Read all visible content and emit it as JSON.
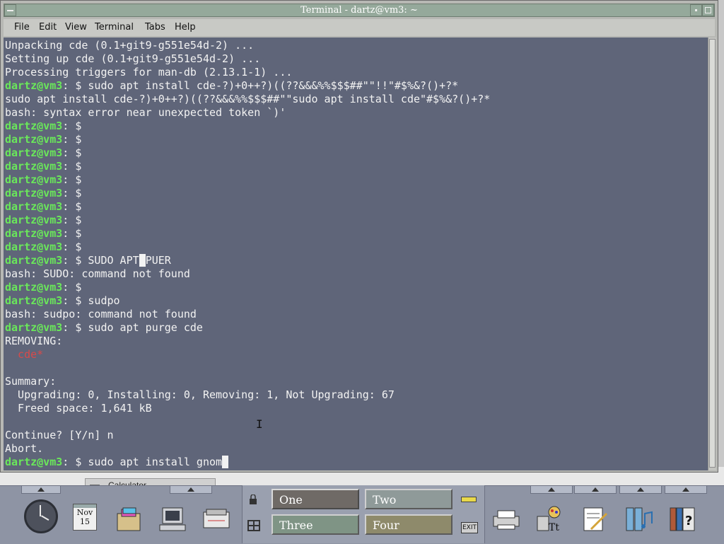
{
  "window": {
    "title": "Terminal - dartz@vm3: ~"
  },
  "menu": [
    "File",
    "Edit",
    "View",
    "Terminal",
    "Tabs",
    "Help"
  ],
  "terminal": {
    "prompt_user": "dartz@vm3",
    "prompt_suffix": ": $ ",
    "lines": [
      {
        "t": "text",
        "text": "Unpacking cde (0.1+git9-g551e54d-2) ..."
      },
      {
        "t": "text",
        "text": "Setting up cde (0.1+git9-g551e54d-2) ..."
      },
      {
        "t": "text",
        "text": "Processing triggers for man-db (2.13.1-1) ..."
      },
      {
        "t": "prompt",
        "cmd": "sudo apt install cde-?)+0++?)((??&&&%%$$$##\"\"!!\"#$%&?()+?*"
      },
      {
        "t": "text",
        "text": "sudo apt install cde-?)+0++?)((??&&&%%$$$##\"\"sudo apt install cde\"#$%&?()+?*"
      },
      {
        "t": "text",
        "text": "bash: syntax error near unexpected token `)'"
      },
      {
        "t": "prompt",
        "cmd": ""
      },
      {
        "t": "prompt",
        "cmd": ""
      },
      {
        "t": "prompt",
        "cmd": ""
      },
      {
        "t": "prompt",
        "cmd": ""
      },
      {
        "t": "prompt",
        "cmd": ""
      },
      {
        "t": "prompt",
        "cmd": ""
      },
      {
        "t": "prompt",
        "cmd": ""
      },
      {
        "t": "prompt",
        "cmd": ""
      },
      {
        "t": "prompt",
        "cmd": ""
      },
      {
        "t": "prompt",
        "cmd": ""
      },
      {
        "t": "prompt",
        "cmd": "SUDO APT",
        "cursor": " ",
        "after": "PUER"
      },
      {
        "t": "text",
        "text": "bash: SUDO: command not found"
      },
      {
        "t": "prompt",
        "cmd": ""
      },
      {
        "t": "prompt",
        "cmd": "sudpo"
      },
      {
        "t": "text",
        "text": "bash: sudpo: command not found"
      },
      {
        "t": "prompt",
        "cmd": "sudo apt purge cde"
      },
      {
        "t": "text",
        "text": "REMOVING:"
      },
      {
        "t": "red",
        "text": "  cde*"
      },
      {
        "t": "text",
        "text": ""
      },
      {
        "t": "text",
        "text": "Summary:"
      },
      {
        "t": "text",
        "text": "  Upgrading: 0, Installing: 0, Removing: 1, Not Upgrading: 67"
      },
      {
        "t": "text",
        "text": "  Freed space: 1,641 kB"
      },
      {
        "t": "text",
        "text": ""
      },
      {
        "t": "text",
        "text": "Continue? [Y/n] n"
      },
      {
        "t": "text",
        "text": "Abort."
      },
      {
        "t": "prompt",
        "cmd": "sudo apt install gnom",
        "cursor": " "
      }
    ]
  },
  "background": {
    "calculator_label": "Calculator"
  },
  "front_panel": {
    "calendar_month": "Nov",
    "calendar_day": "15",
    "workspaces": [
      "One",
      "Two",
      "Three",
      "Four"
    ],
    "exit_label": "EXIT"
  },
  "colors": {
    "terminal_bg": "#5f6579",
    "terminal_fg": "#f2f2f2",
    "prompt": "#6ae85a",
    "error_red": "#d84a4a",
    "titlebar": "#95a99b",
    "panel": "#8e94a4"
  }
}
